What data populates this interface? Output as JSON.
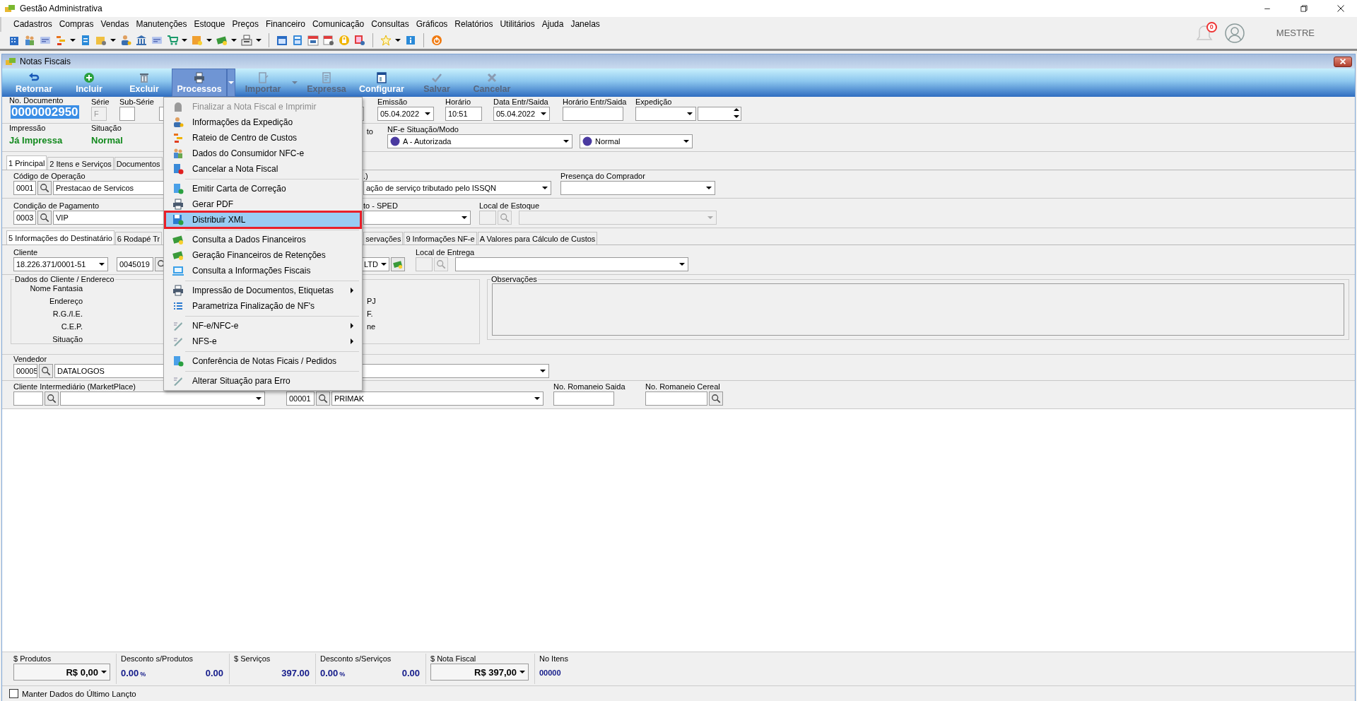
{
  "app": {
    "title": "Gestão Administrativa"
  },
  "menu_bar": [
    "Cadastros",
    "Compras",
    "Vendas",
    "Manutenções",
    "Estoque",
    "Preços",
    "Financeiro",
    "Comunicação",
    "Consultas",
    "Gráficos",
    "Relatórios",
    "Utilitários",
    "Ajuda",
    "Janelas"
  ],
  "user": {
    "notifications": "0",
    "name": "MESTRE"
  },
  "child_window": {
    "title": "Notas Fiscais"
  },
  "actions": [
    {
      "label": "Retornar",
      "disabled": false,
      "pressed": false
    },
    {
      "label": "Incluir",
      "disabled": false,
      "pressed": false
    },
    {
      "label": "Excluir",
      "disabled": false,
      "pressed": false
    },
    {
      "label": "Processos",
      "disabled": false,
      "pressed": true
    },
    {
      "label": "Importar",
      "disabled": true,
      "pressed": false
    },
    {
      "label": "Expressa",
      "disabled": true,
      "pressed": false
    },
    {
      "label": "Configurar",
      "disabled": false,
      "pressed": false
    },
    {
      "label": "Salvar",
      "disabled": true,
      "pressed": false
    },
    {
      "label": "Cancelar",
      "disabled": true,
      "pressed": false
    }
  ],
  "header": {
    "no_documento": {
      "label": "No. Documento",
      "value": "0000002950"
    },
    "serie": {
      "label": "Série",
      "value": "F",
      "disabled": true
    },
    "sub_serie": {
      "label": "Sub-Série"
    },
    "emissao": {
      "label": "Emissão",
      "value": "05.04.2022"
    },
    "horario": {
      "label": "Horário",
      "value": "10:51"
    },
    "data_entr_saida": {
      "label": "Data Entr/Saida",
      "value": "05.04.2022"
    },
    "horario_entr_saida": {
      "label": "Horário Entr/Saida"
    },
    "expedicao": {
      "label": "Expedição"
    }
  },
  "status": {
    "impressao": {
      "label": "Impressão",
      "value": "Já Impressa"
    },
    "situacao": {
      "label": "Situação",
      "value": "Normal"
    },
    "field_3": {
      "label": "to"
    },
    "nfe_situacao_modo": {
      "label": "NF-e Situação/Modo",
      "status": "A - Autorizada",
      "mode": "Normal"
    }
  },
  "tabs": [
    {
      "label": "1 Principal",
      "selected": true
    },
    {
      "label": "2 Itens e Serviços",
      "selected": false
    },
    {
      "label": "Documentos",
      "selected": false
    }
  ],
  "principal": {
    "codigo_operacao": {
      "label": "Código de Operação",
      "code": "0001",
      "name": "Prestacao de Servicos"
    },
    "field_2": {
      "label": ".)",
      "value": "ação de serviço tributado pelo ISSQN"
    },
    "presenca_comprador": {
      "label": "Presença do Comprador"
    },
    "condicao_pagamento": {
      "label": "Condição de Pagamento",
      "code": "0003",
      "name": "VIP"
    },
    "field_5": {
      "label": "to - SPED"
    },
    "local_estoque": {
      "label": "Local de Estoque",
      "disabled": true
    }
  },
  "subtabs": [
    {
      "label": "5 Informações do Destinatário",
      "selected": true
    },
    {
      "label": "6 Rodapé Tr",
      "selected": false
    },
    {
      "label": "servações",
      "selected": false
    },
    {
      "label": "9 Informações NF-e",
      "selected": false
    },
    {
      "label": "A Valores para Cálculo de Custos",
      "selected": false
    }
  ],
  "destinatario": {
    "cliente": {
      "label": "Cliente",
      "document": "18.226.371/0001-51",
      "code": "0045019"
    },
    "field_2": {
      "value": "LTD"
    },
    "local_entrega": {
      "label": "Local de Entrega",
      "disabled": true
    },
    "dados_cliente": {
      "title": "Dados do Cliente / Endereco",
      "labels": [
        "Nome Fantasia",
        "Endereço",
        "R.G./I.E.",
        "C.E.P.",
        "Situação"
      ],
      "labels_2": [
        "PJ",
        "F.",
        "ne"
      ]
    },
    "observacoes": {
      "title": "Observações"
    },
    "vendedor": {
      "label": "Vendedor",
      "code": "00005",
      "name": "DATALOGOS"
    },
    "cliente_intermediario": {
      "label": "Cliente Intermediário (MarketPlace)"
    },
    "field_7": {
      "code": "00001",
      "name": "PRIMAK"
    },
    "romaneio_saida": {
      "label": "No. Romaneio Saida"
    },
    "romaneio_cereal": {
      "label": "No. Romaneio Cereal"
    }
  },
  "totals": {
    "produtos": {
      "label": "$ Produtos",
      "value": "R$ 0,00"
    },
    "desconto_produtos": {
      "label": "Desconto s/Produtos",
      "percent": "0.00",
      "percent_sign": "%",
      "value": "0.00"
    },
    "servicos": {
      "label": "$ Serviços",
      "value": "397.00"
    },
    "desconto_servicos": {
      "label": "Desconto s/Serviços",
      "percent": "0.00",
      "percent_sign": "%",
      "value": "0.00"
    },
    "nota_fiscal": {
      "label": "$ Nota Fiscal",
      "value": "R$ 397,00"
    },
    "no_itens": {
      "label": "No Itens",
      "value": "00000"
    }
  },
  "footer": {
    "label": "Manter Dados do Último Lançto",
    "checked": false
  },
  "menu": [
    {
      "kind": "item",
      "label": "Finalizar a Nota Fiscal e Imprimir",
      "disabled": true,
      "selected": false,
      "submenu": false
    },
    {
      "kind": "item",
      "label": "Informações da Expedição",
      "disabled": false,
      "selected": false,
      "submenu": false
    },
    {
      "kind": "item",
      "label": "Rateio de Centro de Custos",
      "disabled": false,
      "selected": false,
      "submenu": false
    },
    {
      "kind": "item",
      "label": "Dados do Consumidor NFC-e",
      "disabled": false,
      "selected": false,
      "submenu": false
    },
    {
      "kind": "item",
      "label": "Cancelar a Nota Fiscal",
      "disabled": false,
      "selected": false,
      "submenu": false
    },
    {
      "kind": "separator"
    },
    {
      "kind": "item",
      "label": "Emitir Carta de Correção",
      "disabled": false,
      "selected": false,
      "submenu": false
    },
    {
      "kind": "item",
      "label": "Gerar PDF",
      "disabled": false,
      "selected": false,
      "submenu": false
    },
    {
      "kind": "item",
      "label": "Distribuir XML",
      "disabled": false,
      "selected": true,
      "submenu": false
    },
    {
      "kind": "separator"
    },
    {
      "kind": "item",
      "label": "Consulta a Dados Financeiros",
      "disabled": false,
      "selected": false,
      "submenu": false
    },
    {
      "kind": "item",
      "label": "Geração Financeiros de Retenções",
      "disabled": false,
      "selected": false,
      "submenu": false
    },
    {
      "kind": "item",
      "label": "Consulta a Informações Fiscais",
      "disabled": false,
      "selected": false,
      "submenu": false
    },
    {
      "kind": "separator"
    },
    {
      "kind": "item",
      "label": "Impressão de Documentos, Etiquetas",
      "disabled": false,
      "selected": false,
      "submenu": true
    },
    {
      "kind": "item",
      "label": "Parametriza Finalização de NF's",
      "disabled": false,
      "selected": false,
      "submenu": false
    },
    {
      "kind": "separator"
    },
    {
      "kind": "item",
      "label": "NF-e/NFC-e",
      "disabled": false,
      "selected": false,
      "submenu": true
    },
    {
      "kind": "item",
      "label": "NFS-e",
      "disabled": false,
      "selected": false,
      "submenu": true
    },
    {
      "kind": "separator"
    },
    {
      "kind": "item",
      "label": "Conferência de Notas Ficais / Pedidos",
      "disabled": false,
      "selected": false,
      "submenu": false
    },
    {
      "kind": "separator"
    },
    {
      "kind": "item",
      "label": "Alterar Situação para Erro",
      "disabled": false,
      "selected": false,
      "submenu": false
    }
  ]
}
